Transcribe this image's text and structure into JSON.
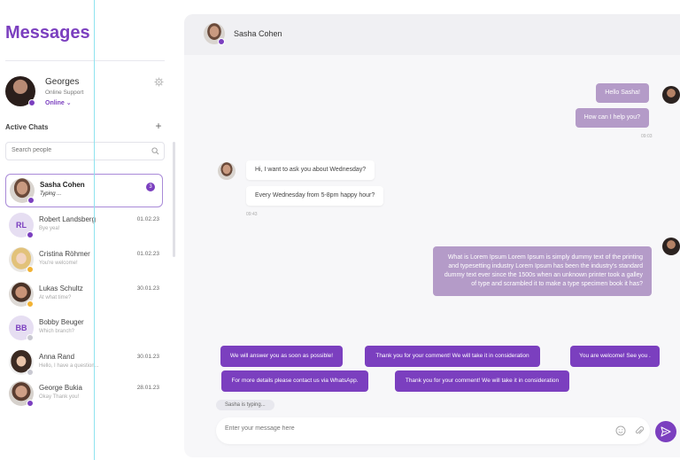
{
  "sidebar": {
    "title": "Messages",
    "profile": {
      "name": "Georges",
      "role": "Online Support",
      "status": "Online ⌄"
    },
    "active_chats_label": "Active Chats",
    "search_placeholder": "Search people",
    "chats": [
      {
        "name": "Sasha Cohen",
        "preview": "Typing ...",
        "badge": "3",
        "date": ""
      },
      {
        "name": "Robert Landsberg",
        "initials": "RL",
        "preview": "Bye yea!",
        "date": "01.02.23"
      },
      {
        "name": "Cristina Röhmer",
        "preview": "You're welcome!",
        "date": "01.02.23"
      },
      {
        "name": "Lukas Schultz",
        "preview": "At what time?",
        "date": "30.01.23"
      },
      {
        "name": "Bobby Beuger",
        "initials": "BB",
        "preview": "Which branch?",
        "date": "30.01.23"
      },
      {
        "name": "Anna Rand",
        "preview": "Hello, I have a question...",
        "date": "30.01.23"
      },
      {
        "name": "George Bukia",
        "preview": "Okay Thank you!",
        "date": "28.01.23"
      }
    ]
  },
  "chat": {
    "contact_name": "Sasha Cohen",
    "messages": [
      {
        "text": "Hello Sasha!"
      },
      {
        "text": "How can I help you?",
        "time": "09:03"
      },
      {
        "text": "Hi, I want to ask you about Wednesday?"
      },
      {
        "text": "Every Wednesday from 5-8pm happy hour?",
        "time": "09:43"
      },
      {
        "text": "What is Lorem Ipsum Lorem Ipsum is simply dummy text of the printing and typesetting industry Lorem Ipsum has been the industry's standard dummy text ever since the 1500s when an unknown printer took a galley of type and scrambled it to make a type specimen book it has?"
      }
    ],
    "quick_replies": [
      "We will answer you as soon as possible!",
      "Thank you for your comment! We will take it in consideration",
      "You are welcome! See you .",
      "For more details please contact us  via WhatsApp.",
      "Thank you for your comment! We will take it in consideration"
    ],
    "typing_indicator": "Sasha is typing...",
    "composer_placeholder": "Enter your message here"
  },
  "colors": {
    "accent": "#7b3fbf",
    "bubble_out": "#b49bc8"
  }
}
